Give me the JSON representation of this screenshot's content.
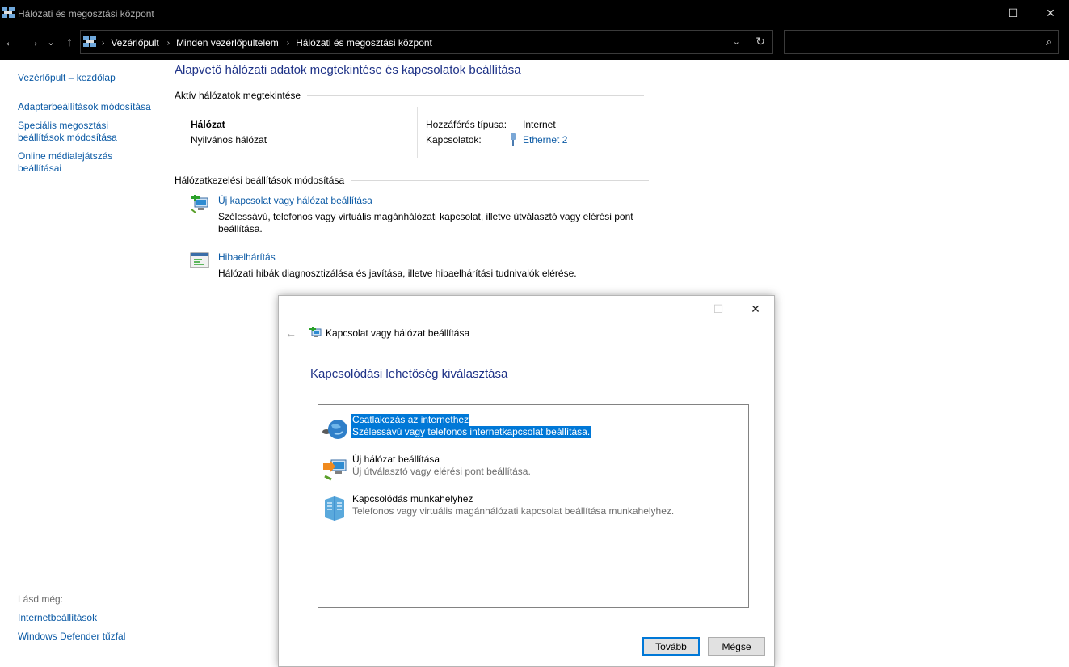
{
  "window": {
    "title": "Hálózati és megosztási központ",
    "controls": {
      "minimize": "—",
      "maximize": "☐",
      "close": "✕"
    }
  },
  "nav": {
    "back": "←",
    "forward": "→",
    "recent": "⌄",
    "up": "↑",
    "breadcrumbs": [
      "Vezérlőpult",
      "Minden vezérlőpultelem",
      "Hálózati és megosztási központ"
    ],
    "dropdown": "⌄",
    "refresh": "↻",
    "search_value": "",
    "search_placeholder": "",
    "search_icon": "⌕"
  },
  "sidebar": {
    "home": "Vezérlőpult – kezdőlap",
    "items": [
      "Adapterbeállítások módosítása",
      "Speciális megosztási beállítások módosítása",
      "Online médialejátszás beállításai"
    ],
    "see_also_label": "Lásd még:",
    "see_also": [
      "Internetbeállítások",
      "Windows Defender tűzfal"
    ]
  },
  "main": {
    "title": "Alapvető hálózati adatok megtekintése és kapcsolatok beállítása",
    "active_networks_heading": "Aktív hálózatok megtekintése",
    "network": {
      "name": "Hálózat",
      "type": "Nyilvános hálózat",
      "access_type_label": "Hozzáférés típusa:",
      "access_type_value": "Internet",
      "connections_label": "Kapcsolatok:",
      "connections_value": "Ethernet 2"
    },
    "change_settings_heading": "Hálózatkezelési beállítások módosítása",
    "tasks": [
      {
        "title": "Új kapcsolat vagy hálózat beállítása",
        "desc": "Szélessávú, telefonos vagy virtuális magánhálózati kapcsolat, illetve útválasztó vagy elérési pont beállítása."
      },
      {
        "title": "Hibaelhárítás",
        "desc": "Hálózati hibák diagnosztizálása és javítása, illetve hibaelhárítási tudnivalók elérése."
      }
    ]
  },
  "dialog": {
    "controls": {
      "minimize": "—",
      "maximize": "☐",
      "close": "✕"
    },
    "back": "←",
    "app_title": "Kapcsolat vagy hálózat beállítása",
    "heading": "Kapcsolódási lehetőség kiválasztása",
    "options": [
      {
        "title": "Csatlakozás az internethez",
        "desc": "Szélessávú vagy telefonos internetkapcsolat beállítása.",
        "selected": true
      },
      {
        "title": "Új hálózat beállítása",
        "desc": "Új útválasztó vagy elérési pont beállítása.",
        "selected": false
      },
      {
        "title": "Kapcsolódás munkahelyhez",
        "desc": "Telefonos vagy virtuális magánhálózati kapcsolat beállítása munkahelyhez.",
        "selected": false
      }
    ],
    "next_button": "Tovább",
    "cancel_button": "Mégse"
  },
  "colors": {
    "link": "#0b5aa5",
    "heading": "#1e3287",
    "selection": "#0078d7",
    "titlebar": "#000000"
  }
}
